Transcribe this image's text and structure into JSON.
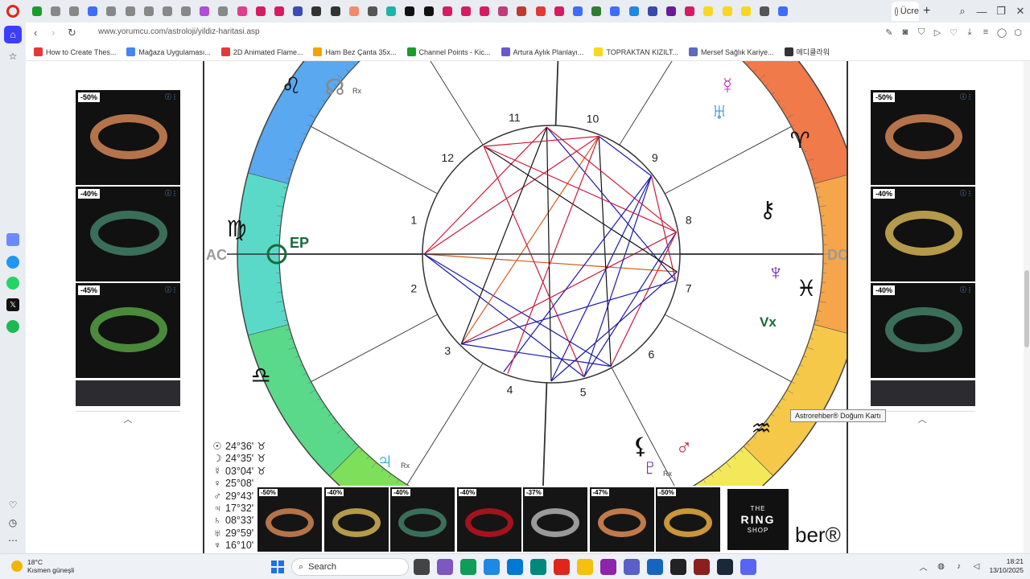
{
  "browser": {
    "url": "www.yorumcu.com/astroloji/yildiz-haritasi.asp",
    "active_tab_title": "Ücre",
    "tab_favicon_colors": [
      "#1a9e2b",
      "#888888",
      "#888888",
      "#3d6cff",
      "#888888",
      "#888888",
      "#888888",
      "#888888",
      "#888888",
      "#b04cd6",
      "#888888",
      "#e23c8e",
      "#d81b60",
      "#d81b60",
      "#3b4bb8",
      "#333333",
      "#333333",
      "#f28b6c",
      "#555555",
      "#1db4a8",
      "#111111",
      "#111111",
      "#d81b60",
      "#d81b60",
      "#d81b60",
      "#c23b7b",
      "#c0392b",
      "#e53935",
      "#d81b60",
      "#3d6cff",
      "#2e7d32",
      "#3d6cff",
      "#1e88e5",
      "#3949ab",
      "#6a1b9a",
      "#d81b60",
      "#f9d71c",
      "#f9d71c",
      "#f9d71c",
      "#555555",
      "#3d6cff"
    ],
    "new_tab_icon": "+",
    "window_controls": [
      "search-icon",
      "minimize-icon",
      "restore-icon",
      "close-icon"
    ]
  },
  "nav": {
    "back": "‹",
    "forward": "›",
    "reload": "↻"
  },
  "bookmarks": [
    {
      "label": "How to Create Thes...",
      "color": "#e53935"
    },
    {
      "label": "Mağaza Uygulaması...",
      "color": "#4285f4"
    },
    {
      "label": "2D Animated Flame...",
      "color": "#e53935"
    },
    {
      "label": "Ham Bez Çanta 35x...",
      "color": "#f4a300"
    },
    {
      "label": "Channel Points - Kic...",
      "color": "#1a9e2b"
    },
    {
      "label": "Artura Aylık Planlayı...",
      "color": "#6a5acd"
    },
    {
      "label": "TOPRAKTAN KIZILT...",
      "color": "#f9d71c"
    },
    {
      "label": "Mersef Sağlık Kariye...",
      "color": "#5c6bc0"
    },
    {
      "label": "메디클라워",
      "color": "#333333"
    }
  ],
  "chart": {
    "house_numbers": [
      "1",
      "2",
      "3",
      "4",
      "5",
      "6",
      "7",
      "8",
      "9",
      "10",
      "11",
      "12"
    ],
    "angles": {
      "asc": "AC",
      "desc": "DC"
    },
    "ep_label": "EP",
    "vertex_label": "Vx",
    "rx_label": "Rx",
    "zodiac_colors": [
      "#ef4e5a",
      "#f07a4a",
      "#f5a54a",
      "#f5c84a",
      "#f3e85a",
      "#c8e85a",
      "#7ee05a",
      "#5ad98a",
      "#5ad9c8",
      "#5aa8ef",
      "#9a7ef0",
      "#d07ef0"
    ]
  },
  "positions": [
    {
      "planet": "☉",
      "degree": "24°36'",
      "sign": "♉"
    },
    {
      "planet": "☽",
      "degree": "24°35'",
      "sign": "♉"
    },
    {
      "planet": "☿",
      "degree": "03°04'",
      "sign": "♉"
    },
    {
      "planet": "♀",
      "degree": "25°08'",
      "sign": ""
    },
    {
      "planet": "♂",
      "degree": "29°43'",
      "sign": ""
    },
    {
      "planet": "♃",
      "degree": "17°32'",
      "sign": ""
    },
    {
      "planet": "♄",
      "degree": "08°33'",
      "sign": ""
    },
    {
      "planet": "♅",
      "degree": "29°59'",
      "sign": ""
    },
    {
      "planet": "♆",
      "degree": "16°10'",
      "sign": ""
    }
  ],
  "tooltip": "Astrorehber® Doğum Kartı",
  "brand_partial": "ber®",
  "left_ads": [
    {
      "discount": "-50%",
      "ring_color": "#b5734a"
    },
    {
      "discount": "-40%",
      "ring_color": "#3a6e5a"
    },
    {
      "discount": "-45%",
      "ring_color": "#4a8a3a"
    }
  ],
  "right_ads": [
    {
      "discount": "-50%",
      "ring_color": "#b5734a"
    },
    {
      "discount": "-40%",
      "ring_color": "#b49a4a"
    },
    {
      "discount": "-40%",
      "ring_color": "#3a6e5a"
    }
  ],
  "bottom_ads": [
    {
      "discount": "-50%",
      "ring_color": "#b5734a"
    },
    {
      "discount": "-40%",
      "ring_color": "#b49a4a"
    },
    {
      "discount": "-40%",
      "ring_color": "#3a6e5a"
    },
    {
      "discount": "-40%",
      "ring_color": "#a3121e"
    },
    {
      "discount": "-37%",
      "ring_color": "#9a9a9a"
    },
    {
      "discount": "-47%",
      "ring_color": "#c07a4a"
    },
    {
      "discount": "-50%",
      "ring_color": "#c9963a"
    }
  ],
  "shop_logo": {
    "line1": "THE",
    "line2": "RING",
    "line3": "SHOP"
  },
  "taskbar": {
    "temperature": "18°C",
    "weather_desc": "Kısmen güneşli",
    "search_placeholder": "Search",
    "time": "18:21",
    "date": "13/10/2025",
    "app_colors": [
      "#444444",
      "#7e57c2",
      "#0f9d58",
      "#1e88e5",
      "#0078d4",
      "#00897b",
      "#e1251b",
      "#f4c20d",
      "#8e24aa",
      "#5b5fc7",
      "#1565c0",
      "#222222",
      "#8b1e1e",
      "#1b2838",
      "#5865f2"
    ]
  }
}
